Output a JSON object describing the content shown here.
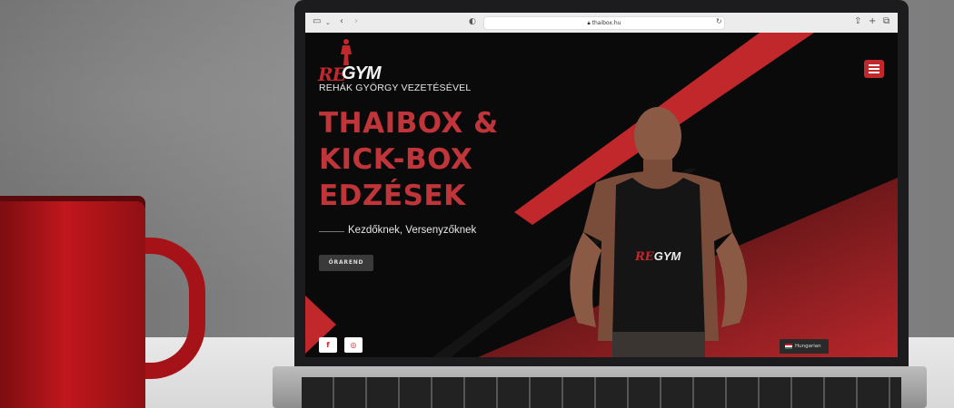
{
  "browser": {
    "url": "thaibox.hu"
  },
  "site": {
    "logo": {
      "part1": "RE",
      "part2": "GYM"
    },
    "subtitle": "REHÁK GYÖRGY VEZETÉSÉVEL",
    "headline": [
      "THAIBOX &",
      "KICK-BOX",
      "EDZÉSEK"
    ],
    "tagline": "Kezdőknek, Versenyzőknek",
    "cta_button": "ÓRAREND",
    "language": "Hungarian",
    "shirt_logo": {
      "part1": "RE",
      "part2": "GYM"
    },
    "social": {
      "facebook": "f",
      "instagram": "◎"
    }
  },
  "colors": {
    "accent": "#c0282c",
    "background": "#0a0a0a"
  }
}
